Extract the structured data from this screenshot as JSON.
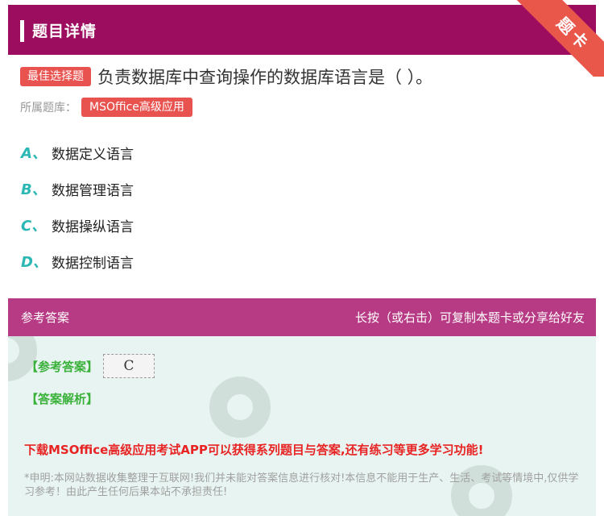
{
  "header": {
    "title": "题目详情",
    "ribbon": "题卡"
  },
  "question": {
    "type_tag": "最佳选择题",
    "text": "负责数据库中查询操作的数据库语言是（   ）。",
    "bank_label": "所属题库：",
    "bank_name": "MSOffice高级应用"
  },
  "options": [
    {
      "letter": "A、",
      "text": "数据定义语言"
    },
    {
      "letter": "B、",
      "text": "数据管理语言"
    },
    {
      "letter": "C、",
      "text": "数据操纵语言"
    },
    {
      "letter": "D、",
      "text": "数据控制语言"
    }
  ],
  "answer_panel": {
    "title": "参考答案",
    "hint": "长按（或右击）可复制本题卡或分享给好友",
    "ref_label": "【参考答案】",
    "ref_value": "C",
    "analysis_label": "【答案解析】",
    "promo": "下载MSOffice高级应用考试APP可以获得系列题目与答案,还有练习等更多学习功能!",
    "disclaimer": "*申明:本网站数据收集整理于互联网!我们并未能对答案信息进行核对!本信息不能用于生产、生活、考试等情境中,仅供学习参考！由此产生任何后果本站不承担责任!"
  },
  "colors": {
    "header": "#9c0d60",
    "panel_header": "#b73a84",
    "accent": "#e85350",
    "option": "#2bb7b3",
    "answer": "#3ab13a",
    "promo": "#e82323"
  }
}
